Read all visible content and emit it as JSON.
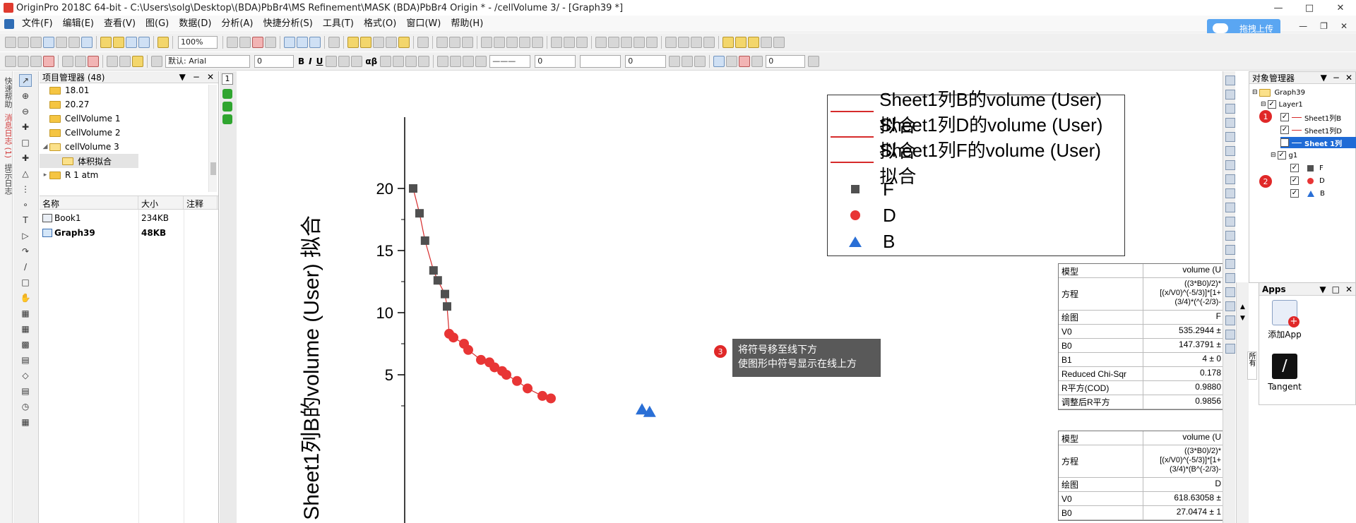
{
  "window": {
    "title": "OriginPro 2018C 64-bit - C:\\Users\\solg\\Desktop\\(BDA)PbBr4\\MS Refinement\\MASK (BDA)PbBr4 Origin * - /cellVolume 3/ - [Graph39 *]",
    "upload_label": "拖拽上传"
  },
  "menu": [
    "文件(F)",
    "编辑(E)",
    "查看(V)",
    "图(G)",
    "数据(D)",
    "分析(A)",
    "快捷分析(S)",
    "工具(T)",
    "格式(O)",
    "窗口(W)",
    "帮助(H)"
  ],
  "toolbar": {
    "zoom": "100%",
    "font": "默认: Arial",
    "font_size": "0",
    "line_width": "0",
    "line_width2": "0",
    "line_width3": "0",
    "bold": "B",
    "italic": "I",
    "underline": "U",
    "greek": "αβ"
  },
  "left_strip": {
    "label1": "快速帮助",
    "label2": "消息日志 (1)",
    "label3": "提示日志"
  },
  "project_manager": {
    "title": "项目管理器 (48)",
    "folders": [
      "18.01",
      "20.27",
      "CellVolume 1",
      "CellVolume 2",
      "cellVolume 3",
      "体积拟合",
      "R 1 atm"
    ],
    "file_headers": [
      "名称",
      "大小",
      "注释"
    ],
    "files": [
      {
        "name": "Book1",
        "size": "234KB",
        "note": ""
      },
      {
        "name": "Graph39",
        "size": "48KB",
        "note": ""
      }
    ]
  },
  "graph": {
    "page_number": "1",
    "y_axis_label": "Sheet1列B的volume (User) 拟合",
    "y_ticks": [
      "20",
      "15",
      "10",
      "5"
    ],
    "legend": [
      {
        "label": "Sheet1列B的volume (User) 拟合",
        "kind": "line"
      },
      {
        "label": "Sheet1列D的volume (User) 拟合",
        "kind": "line"
      },
      {
        "label": "Sheet1列F的volume (User) 拟合",
        "kind": "line"
      },
      {
        "label": "F",
        "kind": "square"
      },
      {
        "label": "D",
        "kind": "circle"
      },
      {
        "label": "B",
        "kind": "triangle"
      }
    ],
    "colors": {
      "F": "#505050",
      "D": "#e83535",
      "B": "#2a6fd6",
      "fit": "#d62b2b"
    }
  },
  "chart_data": {
    "type": "scatter",
    "title": "",
    "xlabel": "",
    "ylabel": "Sheet1列B的volume (User) 拟合",
    "ylim": [
      2.5,
      22
    ],
    "xlim": [
      0,
      10
    ],
    "y_ticks": [
      20,
      15,
      10,
      5
    ],
    "series": [
      {
        "name": "F",
        "marker": "square",
        "x": [
          0.2,
          0.35,
          0.48,
          0.68,
          0.78,
          0.95,
          1.0
        ],
        "y": [
          20.0,
          18.0,
          15.8,
          13.4,
          12.6,
          11.5,
          10.5
        ]
      },
      {
        "name": "D",
        "marker": "circle",
        "x": [
          1.05,
          1.15,
          1.4,
          1.5,
          1.8,
          2.0,
          2.12,
          2.3,
          2.4,
          2.65,
          2.9,
          3.25,
          3.45
        ],
        "y": [
          8.3,
          8.0,
          7.5,
          7.0,
          6.2,
          6.0,
          5.6,
          5.3,
          5.0,
          4.5,
          3.9,
          3.3,
          3.1
        ]
      },
      {
        "name": "B",
        "marker": "triangle",
        "x": [
          5.6,
          5.78
        ],
        "y": [
          2.2,
          2.0
        ]
      }
    ]
  },
  "fit_table_1": {
    "rows": [
      [
        "模型",
        "volume (U"
      ],
      [
        "方程",
        "((3*B0)/2)*[(x/V0)^(-5/3)]*[1+(3/4)*(^(-2/3)-"
      ],
      [
        "绘图",
        "F"
      ],
      [
        "V0",
        "535.2944 ±"
      ],
      [
        "B0",
        "147.3791 ±"
      ],
      [
        "B1",
        "4 ± 0"
      ],
      [
        "Reduced Chi-Sqr",
        "0.178"
      ],
      [
        "R平方(COD)",
        "0.9880"
      ],
      [
        "调整后R平方",
        "0.9856"
      ]
    ]
  },
  "fit_table_2": {
    "rows": [
      [
        "模型",
        "volume (U"
      ],
      [
        "方程",
        "((3*B0)/2)*[(x/V0)^(-5/3)]*[1+(3/4)*(B^(-2/3)-"
      ],
      [
        "绘图",
        "D"
      ],
      [
        "V0",
        "618.63058 ±"
      ],
      [
        "B0",
        "27.0474 ± 1"
      ]
    ]
  },
  "tooltip": {
    "badge": "3",
    "line1": "将符号移至线下方",
    "line2": "使图形中符号显示在线上方"
  },
  "object_manager": {
    "title": "对象管理器",
    "graph": "Graph39",
    "layer": "Layer1",
    "fit_items": [
      "Sheet1列B",
      "Sheet1列D",
      "Sheet 1列"
    ],
    "group": "g1",
    "group_items": [
      "F",
      "D",
      "B"
    ],
    "badge1": "1",
    "badge2": "2"
  },
  "apps": {
    "title": "Apps",
    "tiles": [
      {
        "label": "添加App"
      },
      {
        "label": "Tangent"
      }
    ],
    "side_label": "所有"
  }
}
